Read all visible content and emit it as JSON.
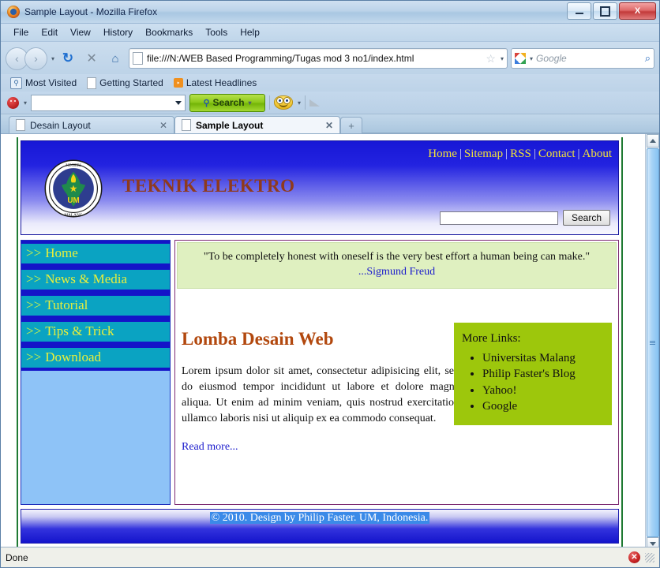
{
  "window": {
    "title": "Sample Layout - Mozilla Firefox",
    "minimize_label": "Minimize",
    "maximize_label": "Maximize",
    "close_label": "X"
  },
  "menubar": {
    "items": [
      "File",
      "Edit",
      "View",
      "History",
      "Bookmarks",
      "Tools",
      "Help"
    ]
  },
  "navbar": {
    "back_label": "‹",
    "forward_label": "›",
    "dropdown_label": "▾",
    "reload_label": "↻",
    "stop_label": "✕",
    "home_label": "⌂",
    "url": "file:///N:/WEB Based Programming/Tugas mod 3 no1/index.html",
    "star_label": "☆",
    "star_dropdown_label": "▾",
    "search_placeholder": "Google",
    "search_value": "",
    "search_go_label": "⌕",
    "engine_dropdown_label": "▾"
  },
  "bookmarks": {
    "items": [
      {
        "label": "Most Visited",
        "icon": "search-bookmark-icon"
      },
      {
        "label": "Getting Started",
        "icon": "page-icon"
      },
      {
        "label": "Latest Headlines",
        "icon": "rss-icon"
      }
    ]
  },
  "addon_toolbar": {
    "avatar_icon": "red-smiley-icon",
    "avatar_dropdown": "▾",
    "input_value": "",
    "input_dropdown": "▾",
    "search_button_label": "Search",
    "search_button_dropdown": "▾",
    "smiley_icon": "yellow-smiley-icon",
    "smiley_dropdown": "▾"
  },
  "tabs": {
    "items": [
      {
        "label": "Desain Layout",
        "active": false,
        "close_label": "✕"
      },
      {
        "label": "Sample Layout",
        "active": true,
        "close_label": "✕"
      }
    ],
    "new_tab_label": "+"
  },
  "page": {
    "topnav": [
      "Home",
      "Sitemap",
      "RSS",
      "Contact",
      "About"
    ],
    "topnav_separator": "|",
    "logo_alt": "Universitas Negeri Malang seal",
    "site_title": "TEKNIK ELEKTRO",
    "header_search": {
      "value": "",
      "placeholder": "",
      "button_label": "Search"
    },
    "sidebar": {
      "chevron": ">>",
      "items": [
        "Home",
        "News & Media",
        "Tutorial",
        "Tips & Trick",
        "Download"
      ]
    },
    "quote": {
      "text": "\"To be completely honest with oneself is the very best effort a human being can make.\"",
      "author": "...Sigmund Freud"
    },
    "article": {
      "heading": "Lomba Desain Web",
      "body": "Lorem ipsum dolor sit amet, consectetur adipisicing elit, sed do eiusmod tempor incididunt ut labore et dolore magna aliqua. Ut enim ad minim veniam, quis nostrud exercitation ullamco laboris nisi ut aliquip ex ea commodo consequat.",
      "readmore": "Read more..."
    },
    "more_links": {
      "title": "More Links:",
      "items": [
        "Universitas Malang",
        "Philip Faster's Blog",
        "Yahoo!",
        "Google"
      ]
    },
    "footer": "© 2010. Design by Philip Faster. UM, Indonesia."
  },
  "statusbar": {
    "text": "Done",
    "error_icon_label": "✕"
  },
  "colors": {
    "header_blue": "#1717d6",
    "site_title_brown": "#8e3a1e",
    "sidebar_item_teal": "#0aa3c2",
    "sidebar_item_text": "#e8ef3c",
    "sidebar_bg": "#8ec3f7",
    "quote_bg": "#dff0c0",
    "quote_border": "#7d2b72",
    "more_links_bg": "#9dc70c",
    "heading_brown": "#b2480e",
    "link_blue": "#1a1acc",
    "page_border_green": "#1f7a33",
    "footer_highlight": "#3b8ae8"
  }
}
